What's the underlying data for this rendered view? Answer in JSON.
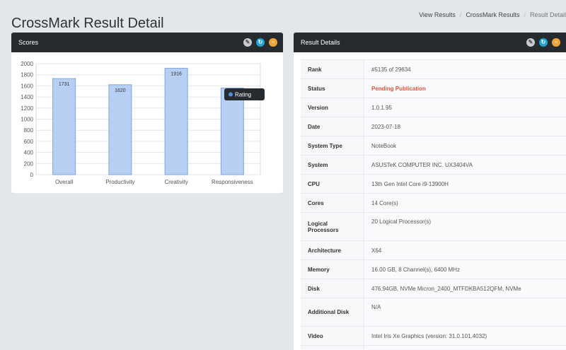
{
  "page": {
    "title": "CrossMark Result Detail",
    "breadcrumb": [
      "View Results",
      "CrossMark Results",
      "Result Detail"
    ]
  },
  "scores_panel": {
    "title": "Scores",
    "tools": [
      "wrench-icon",
      "refresh-icon",
      "collapse-icon"
    ]
  },
  "details_panel": {
    "title": "Result Details",
    "tools": [
      "wrench-icon",
      "refresh-icon",
      "collapse-icon"
    ],
    "rows": [
      {
        "key": "Rank",
        "value": "#5135 of 29634"
      },
      {
        "key": "Status",
        "value": "Pending Publication"
      },
      {
        "key": "Version",
        "value": "1.0.1.95"
      },
      {
        "key": "Date",
        "value": "2023-07-18"
      },
      {
        "key": "System Type",
        "value": "NoteBook"
      },
      {
        "key": "System",
        "value": "ASUSTeK COMPUTER INC. UX3404VA"
      },
      {
        "key": "CPU",
        "value": "13th Gen Intel Core i9-13900H"
      },
      {
        "key": "Cores",
        "value": "14 Core(s)"
      },
      {
        "key": "Logical Processors",
        "value": "20 Logical Processor(s)"
      },
      {
        "key": "Architecture",
        "value": "X64"
      },
      {
        "key": "Memory",
        "value": "16.00 GB, 8 Channel(s), 6400 MHz"
      },
      {
        "key": "Disk",
        "value": "476.94GB, NVMe Micron_2400_MTFDKBA512QFM, NVMe"
      },
      {
        "key": "Additional Disk",
        "value": "N/A"
      },
      {
        "key": "Video",
        "value": "Intel Iris Xe Graphics (version: 31.0.101.4032)"
      }
    ]
  },
  "colors": {
    "header_bg": "#262b30",
    "bar_fill": "#b7cff2",
    "bar_stroke": "#7fa6de",
    "pending": "#e0533e",
    "legend_dot": "#4a90d9"
  },
  "chart_data": {
    "type": "bar",
    "categories": [
      "Overall",
      "Productivity",
      "Creativity",
      "Responsiveness"
    ],
    "series": [
      {
        "name": "Rating",
        "values": [
          1731,
          1620,
          1916,
          1561
        ]
      }
    ],
    "ylim": [
      0,
      2000
    ],
    "yticks": [
      0,
      200,
      400,
      600,
      800,
      1000,
      1200,
      1400,
      1600,
      1800,
      2000
    ],
    "grid": true,
    "legend": "top-right",
    "data_labels": true
  }
}
